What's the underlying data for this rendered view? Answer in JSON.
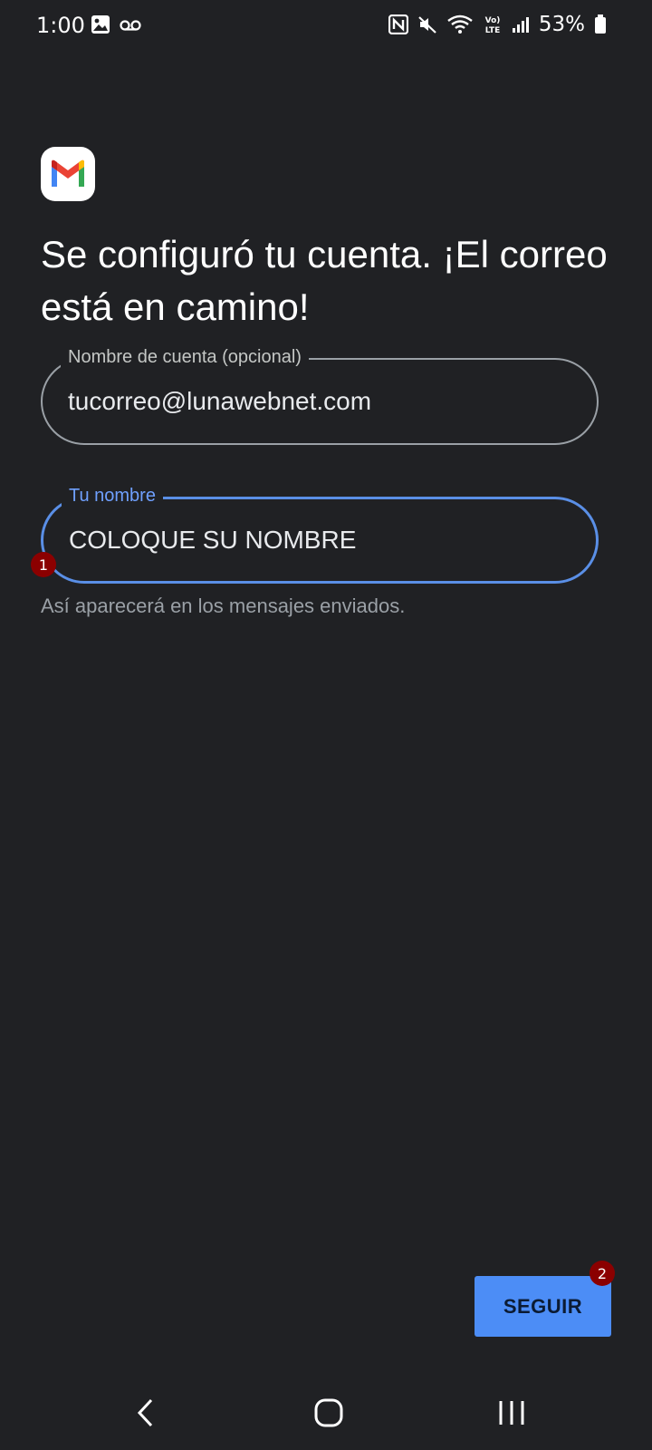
{
  "status_bar": {
    "time": "1:00",
    "left_icons": [
      "gallery-icon",
      "voicemail-icon"
    ],
    "right_icons": [
      "nfc-icon",
      "mute-icon",
      "wifi-icon",
      "volte-icon",
      "signal-icon"
    ],
    "battery_percent": "53%"
  },
  "app": {
    "logo": "gmail-logo"
  },
  "heading": "Se configuró tu cuenta. ¡El correo está en camino!",
  "account_name_field": {
    "label": "Nombre de cuenta (opcional)",
    "value": "tucorreo@lunawebnet.com"
  },
  "your_name_field": {
    "label": "Tu nombre",
    "value": "COLOQUE SU NOMBRE",
    "helper": "Así aparecerá en los mensajes enviados."
  },
  "annotations": {
    "badge_1": "1",
    "badge_2": "2"
  },
  "continue_button": {
    "label": "SEGUIR"
  },
  "nav_bar": {
    "items": [
      "back-icon",
      "home-icon",
      "recents-icon"
    ]
  },
  "colors": {
    "background": "#202124",
    "accent": "#4c8df6",
    "badge": "#8b0000"
  }
}
